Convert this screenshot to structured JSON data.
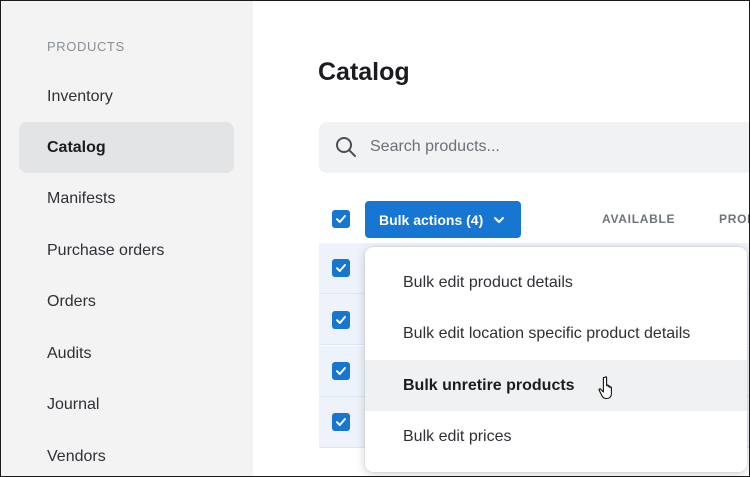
{
  "sidebar": {
    "heading": "PRODUCTS",
    "items": [
      {
        "label": "Inventory",
        "active": false
      },
      {
        "label": "Catalog",
        "active": true
      },
      {
        "label": "Manifests",
        "active": false
      },
      {
        "label": "Purchase orders",
        "active": false
      },
      {
        "label": "Orders",
        "active": false
      },
      {
        "label": "Audits",
        "active": false
      },
      {
        "label": "Journal",
        "active": false
      },
      {
        "label": "Vendors",
        "active": false
      }
    ]
  },
  "main": {
    "title": "Catalog",
    "search": {
      "placeholder": "Search products...",
      "icon": "search-icon"
    },
    "bulk_actions": {
      "label": "Bulk actions (4)",
      "icon": "chevron-down-icon"
    },
    "columns": [
      "AVAILABLE",
      "PROD"
    ],
    "rows_checked": [
      true,
      true,
      true,
      true
    ]
  },
  "dropdown": {
    "items": [
      {
        "label": "Bulk edit product details",
        "hover": false
      },
      {
        "label": "Bulk edit location specific product details",
        "hover": false
      },
      {
        "label": "Bulk unretire products",
        "hover": true
      },
      {
        "label": "Bulk edit prices",
        "hover": false
      }
    ]
  },
  "colors": {
    "accent": "#1676d2",
    "sidebar_bg": "#f3f3f4",
    "active_nav_bg": "#e3e4e6",
    "selected_row_bg": "#eef3fb",
    "menu_hover_bg": "#f0f1f2"
  }
}
